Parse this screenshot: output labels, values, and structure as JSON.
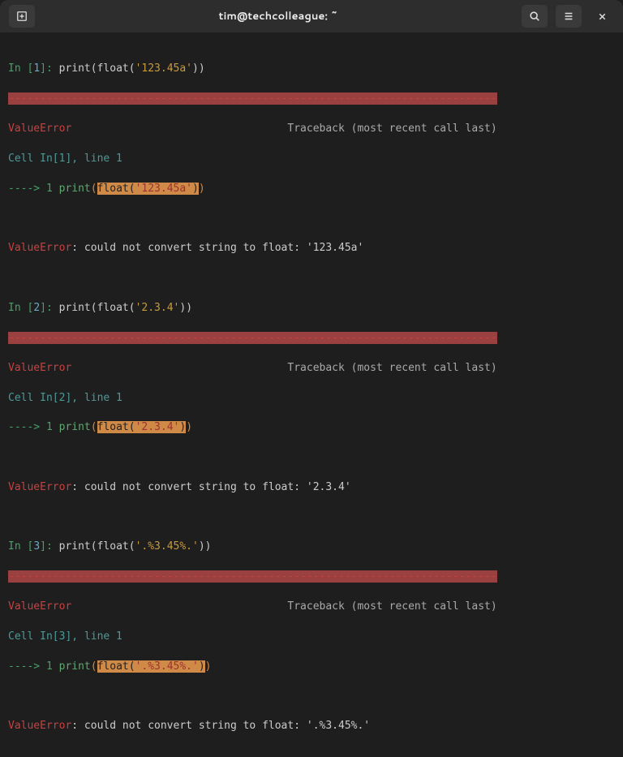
{
  "titlebar": {
    "title": "tim@techcolleague: ~"
  },
  "cells": [
    {
      "in_prefix": "In [",
      "num": "1",
      "in_suffix": "]:",
      "code_print": "print",
      "code_paren_open": "(",
      "code_float": "float",
      "code_inner_open": "(",
      "code_str": "'123.45a'",
      "code_inner_close": ")",
      "code_paren_close": ")",
      "dashes": "-----------------------------------------------------------------------------",
      "err_name": "ValueError",
      "traceback": "Traceback (most recent call last)",
      "cell_ref": "Cell In[1], line 1",
      "arrow": "----> 1 ",
      "tb_print": "print",
      "tb_open": "(",
      "tb_float": "float",
      "tb_inner_open": "(",
      "tb_str": "'123.45a'",
      "tb_inner_close": ")",
      "tb_close": ")",
      "err_msg_name": "ValueError",
      "err_msg": ": could not convert string to float: '123.45a'"
    },
    {
      "in_prefix": "In [",
      "num": "2",
      "in_suffix": "]:",
      "code_print": "print",
      "code_paren_open": "(",
      "code_float": "float",
      "code_inner_open": "(",
      "code_str": "'2.3.4'",
      "code_inner_close": ")",
      "code_paren_close": ")",
      "dashes": "-----------------------------------------------------------------------------",
      "err_name": "ValueError",
      "traceback": "Traceback (most recent call last)",
      "cell_ref": "Cell In[2], line 1",
      "arrow": "----> 1 ",
      "tb_print": "print",
      "tb_open": "(",
      "tb_float": "float",
      "tb_inner_open": "(",
      "tb_str": "'2.3.4'",
      "tb_inner_close": ")",
      "tb_close": ")",
      "err_msg_name": "ValueError",
      "err_msg": ": could not convert string to float: '2.3.4'"
    },
    {
      "in_prefix": "In [",
      "num": "3",
      "in_suffix": "]:",
      "code_print": "print",
      "code_paren_open": "(",
      "code_float": "float",
      "code_inner_open": "(",
      "code_str": "'.%3.45%.'",
      "code_inner_close": ")",
      "code_paren_close": ")",
      "dashes": "-----------------------------------------------------------------------------",
      "err_name": "ValueError",
      "traceback": "Traceback (most recent call last)",
      "cell_ref": "Cell In[3], line 1",
      "arrow": "----> 1 ",
      "tb_print": "print",
      "tb_open": "(",
      "tb_float": "float",
      "tb_inner_open": "(",
      "tb_str": "'.%3.45%.'",
      "tb_inner_close": ")",
      "tb_close": ")",
      "err_msg_name": "ValueError",
      "err_msg": ": could not convert string to float: '.%3.45%.'"
    }
  ]
}
